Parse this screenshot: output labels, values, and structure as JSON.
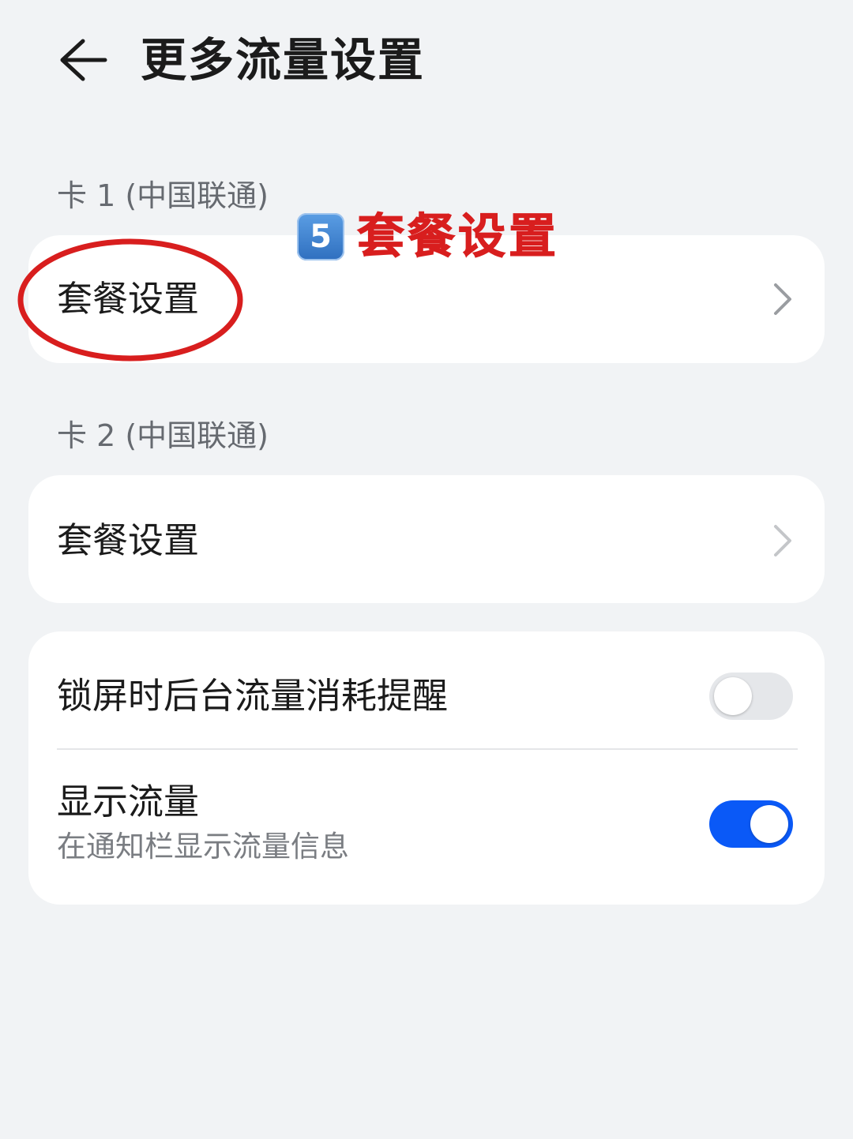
{
  "header": {
    "back_icon": "arrow-left-icon",
    "title": "更多流量设置"
  },
  "card1": {
    "label": "卡 1 (中国联通)",
    "plan_settings": "套餐设置",
    "chevron_icon": "chevron-right-icon"
  },
  "card2": {
    "label": "卡 2 (中国联通)",
    "plan_settings": "套餐设置",
    "chevron_icon": "chevron-right-icon"
  },
  "options": {
    "lock_screen_reminder": {
      "title": "锁屏时后台流量消耗提醒",
      "enabled": false
    },
    "show_traffic": {
      "title": "显示流量",
      "subtitle": "在通知栏显示流量信息",
      "enabled": true
    }
  },
  "annotation": {
    "step_badge": "5",
    "step_text": "套餐设置",
    "color": "#d81e1e"
  },
  "colors": {
    "background": "#f1f3f5",
    "card": "#ffffff",
    "accent": "#0a59f7",
    "toggle_off": "#e5e7ea",
    "secondary_text": "#666a70"
  }
}
